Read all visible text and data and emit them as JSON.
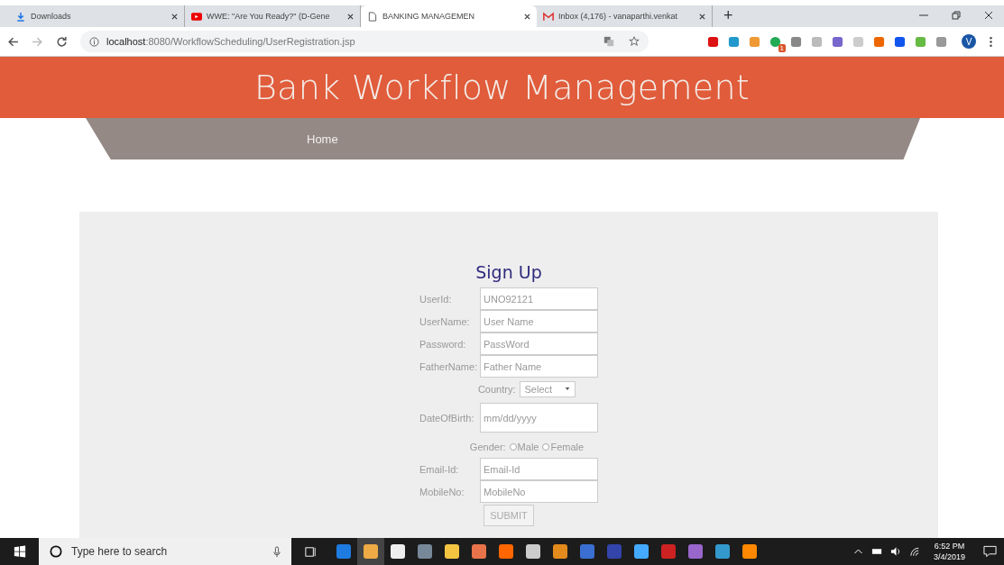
{
  "browser": {
    "tabs": [
      {
        "kind": "download",
        "label": "Downloads",
        "selected": false
      },
      {
        "kind": "video",
        "label": "WWE: \"Are You Ready?\" (D-Gene",
        "selected": false
      },
      {
        "kind": "page",
        "label": "BANKING MANAGEMEN",
        "selected": true
      },
      {
        "kind": "mail",
        "label": "Inbox (4,176) - vanaparthi.venkat",
        "selected": false
      }
    ],
    "new_tab": "+",
    "address_host": "localhost",
    "address_path": ":8080/WorkflowScheduling/UserRegistration.jsp",
    "extension_badge": "1",
    "profile_initial": "V"
  },
  "page": {
    "title": "Bank Workflow Management",
    "nav": [
      "Home"
    ],
    "form": {
      "title": "Sign Up",
      "fields": [
        {
          "kind": "text",
          "label": "UserId:",
          "value": "UNO92121"
        },
        {
          "kind": "text",
          "label": "UserName:",
          "placeholder": "User Name"
        },
        {
          "kind": "text",
          "label": "Password:",
          "placeholder": "PassWord"
        },
        {
          "kind": "text",
          "label": "FatherName:",
          "placeholder": "Father Name"
        },
        {
          "kind": "select",
          "label": "Country:",
          "value": "Select"
        },
        {
          "kind": "date",
          "label": "DateOfBirth:",
          "placeholder": "mm/dd/yyyy"
        },
        {
          "kind": "radio",
          "label": "Gender:",
          "options": [
            {
              "label": "Male",
              "selected": false
            },
            {
              "label": "Female",
              "selected": false
            }
          ]
        },
        {
          "kind": "text",
          "label": "Email-Id:",
          "placeholder": "Email-Id"
        },
        {
          "kind": "text",
          "label": "MobileNo:",
          "placeholder": "MobileNo"
        }
      ],
      "submit": "SUBMIT"
    }
  },
  "taskbar": {
    "search_placeholder": "Type here to search",
    "time": "6:52 PM",
    "date": "3/4/2019"
  }
}
